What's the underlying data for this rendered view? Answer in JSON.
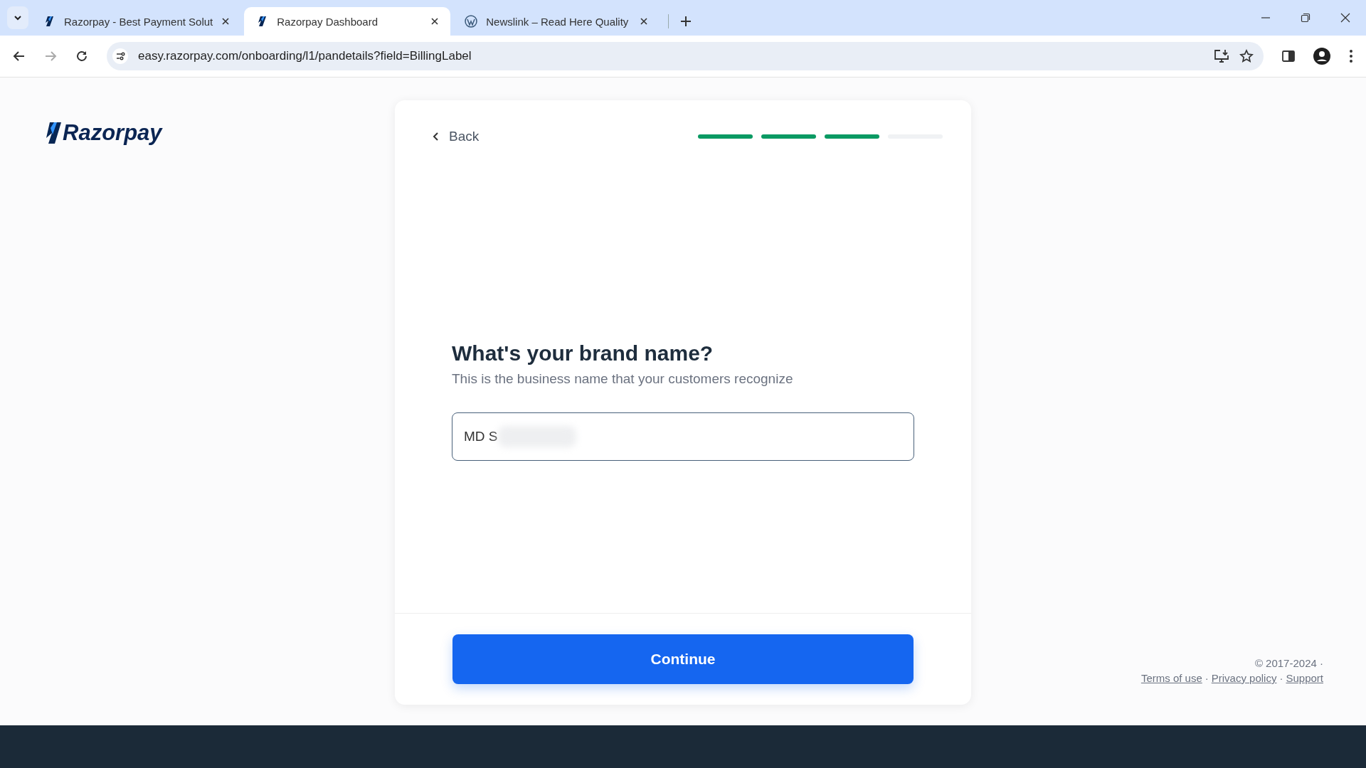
{
  "browser": {
    "tabs": [
      {
        "title": "Razorpay - Best Payment Solut",
        "selected": false
      },
      {
        "title": "Razorpay Dashboard",
        "selected": true
      },
      {
        "title": "Newslink – Read Here Quality",
        "selected": false
      }
    ],
    "url": "easy.razorpay.com/onboarding/l1/pandetails?field=BillingLabel"
  },
  "logo": "Razorpay",
  "card": {
    "back": "Back",
    "steps": [
      {
        "complete": true
      },
      {
        "complete": true
      },
      {
        "complete": true
      },
      {
        "complete": false
      }
    ],
    "question": "What's your brand name?",
    "hint": "This is the business name that your customers recognize",
    "brand_name": "MD S",
    "continue": "Continue"
  },
  "footer": {
    "copyright": "© 2017-2024 ·",
    "links": [
      {
        "kind": "link",
        "text": "Terms of use"
      },
      {
        "kind": "separator",
        "text": "·"
      },
      {
        "kind": "link",
        "text": "Privacy policy"
      },
      {
        "kind": "separator",
        "text": "·"
      },
      {
        "kind": "link",
        "text": "Support"
      }
    ]
  }
}
